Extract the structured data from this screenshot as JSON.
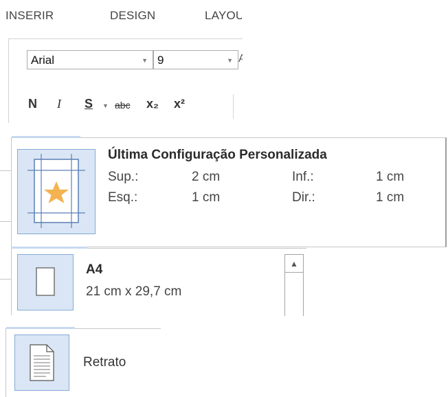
{
  "ribbon": {
    "tabs": [
      {
        "label": "INSERIR"
      },
      {
        "label": "DESIGN"
      },
      {
        "label": "LAYOUT"
      }
    ],
    "font": {
      "value": "Arial"
    },
    "size": {
      "value": "9"
    },
    "format_buttons": [
      {
        "label": "N",
        "name": "bold"
      },
      {
        "label": "I",
        "name": "italic"
      },
      {
        "label": "S",
        "name": "underline"
      },
      {
        "label": "abc",
        "name": "strikethrough"
      },
      {
        "label": "x₂",
        "name": "subscript"
      },
      {
        "label": "x²",
        "name": "superscript"
      }
    ]
  },
  "margins_item": {
    "title": "Última Configuração Personalizada",
    "top_label": "Sup.:",
    "top_value": "2 cm",
    "bottom_label": "Inf.:",
    "bottom_value": "1 cm",
    "left_label": "Esq.:",
    "left_value": "1 cm",
    "right_label": "Dir.:",
    "right_value": "1 cm",
    "icon": "page-margins-star-icon"
  },
  "size_item": {
    "title": "A4",
    "dimensions": "21 cm x 29,7 cm",
    "icon": "page-size-icon"
  },
  "orientation_item": {
    "label": "Retrato",
    "icon": "portrait-page-icon"
  },
  "colors": {
    "selection_fill": "#dae6f5",
    "selection_border": "#84a9d6",
    "star": "#f4b350",
    "margin_lines": "#5b7fb3"
  }
}
